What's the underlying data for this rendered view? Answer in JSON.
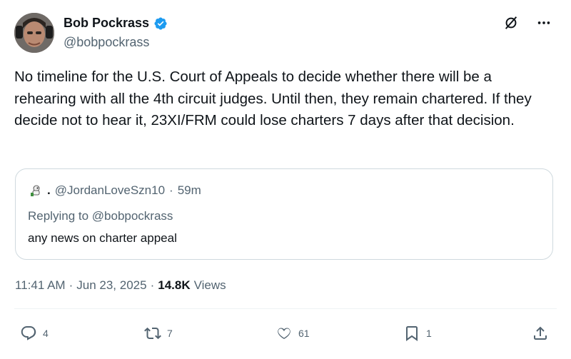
{
  "author": {
    "name": "Bob Pockrass",
    "handle": "@bobpockrass",
    "verified_badge": "verified-badge",
    "accent_color": "#1d9bf0"
  },
  "tweet": {
    "text": "No timeline for the U.S. Court of Appeals to decide whether there will be a rehearing with all the 4th circuit judges. Until then, they remain chartered. If they decide not to hear it, 23XI/FRM could lose charters 7 days after that decision."
  },
  "quote": {
    "display_name": ".",
    "handle": "@JordanLoveSzn10",
    "separator": "·",
    "time": "59m",
    "replying_to": "Replying to @bobpockrass",
    "text": "any news on charter appeal"
  },
  "meta": {
    "time": "11:41 AM",
    "dot": "·",
    "date": "Jun 23, 2025",
    "dot2": "·",
    "views_count": "14.8K",
    "views_label": "Views"
  },
  "actions": {
    "replies": "4",
    "reposts": "7",
    "likes": "61",
    "bookmarks": "1"
  },
  "icons": {
    "grok": "grok-icon",
    "more": "more-icon",
    "reply": "reply-icon",
    "repost": "repost-icon",
    "like": "heart-icon",
    "bookmark": "bookmark-icon",
    "share": "share-icon"
  }
}
